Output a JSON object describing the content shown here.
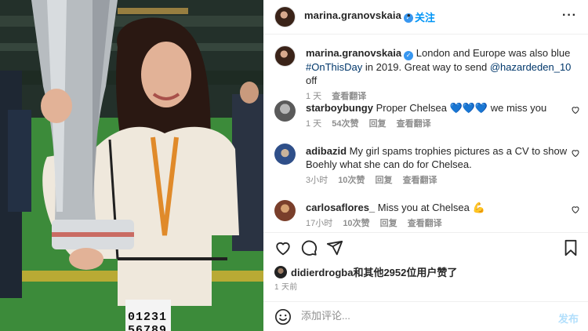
{
  "post": {
    "username": "marina.granovskaia",
    "follow_dot": "•",
    "follow_label": "关注",
    "more_label": "···"
  },
  "caption": {
    "username": "marina.granovskaia",
    "text_1": "London and Europe was also blue ",
    "hashtag": "#OnThisDay",
    "text_2": " in 2019. Great way to send ",
    "mention": "@hazardeden_10",
    "text_3": " off",
    "time": "1 天",
    "translate": "查看翻译"
  },
  "comments": [
    {
      "username": "starboybungy",
      "text": "Proper Chelsea",
      "emoji": "💙💙💙",
      "text_after": " we miss you",
      "time": "1 天",
      "likes": "54次赞",
      "reply": "回复",
      "translate": "查看翻译"
    },
    {
      "username": "adibazid",
      "text": "My girl spams trophies pictures as a CV to show Boehly what she can do for Chelsea.",
      "time": "3小时",
      "likes": "10次赞",
      "reply": "回复",
      "translate": "查看翻译"
    },
    {
      "username": "carlosaflores_",
      "text": "Miss you at Chelsea",
      "emoji": "💪",
      "time": "17小时",
      "likes": "10次赞",
      "reply": "回复",
      "translate": "查看翻译"
    }
  ],
  "likes_line": {
    "user": "didierdrogba",
    "text": "和其他2952位用户赞了"
  },
  "time_ago": "1 天前",
  "comment_box": {
    "placeholder": "添加评论...",
    "post_label": "发布"
  },
  "photo": {
    "badge_top": "01231",
    "badge_bottom": "56789"
  },
  "colors": {
    "accent": "#0095f6",
    "verified": "#3897f0",
    "secondary_text": "#8e8e8e",
    "post_disabled": "#b2dffc"
  }
}
